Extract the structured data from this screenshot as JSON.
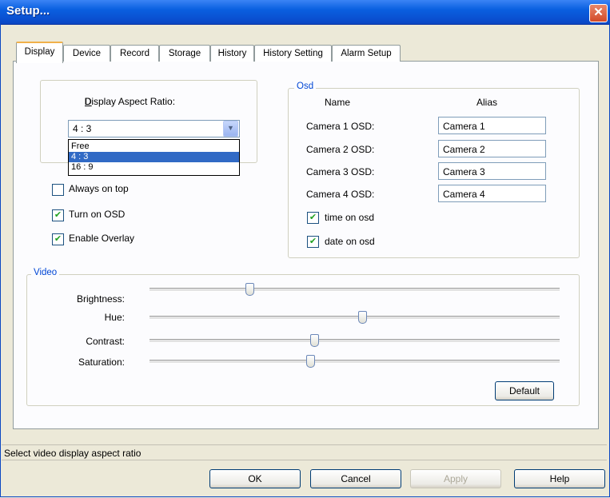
{
  "window": {
    "title": "Setup...",
    "close_glyph": "✕"
  },
  "tabs": [
    "Display",
    "Device",
    "Record",
    "Storage",
    "History",
    "History Setting",
    "Alarm Setup"
  ],
  "display_aspect": {
    "label": "Display Aspect Ratio:",
    "selected": "4 : 3",
    "options": [
      "Free",
      "4 : 3",
      "16 : 9"
    ]
  },
  "checkboxes": {
    "always_on_top": {
      "label": "Always on top",
      "checked": false
    },
    "turn_on_osd": {
      "label": "Turn on OSD",
      "checked": true
    },
    "enable_overlay": {
      "label": "Enable Overlay",
      "checked": true
    }
  },
  "osd": {
    "legend": "Osd",
    "col_name": "Name",
    "col_alias": "Alias",
    "rows": [
      {
        "name": "Camera 1 OSD:",
        "alias": "Camera 1"
      },
      {
        "name": "Camera 2 OSD:",
        "alias": "Camera 2"
      },
      {
        "name": "Camera 3 OSD:",
        "alias": "Camera 3"
      },
      {
        "name": "Camera 4 OSD:",
        "alias": "Camera 4"
      }
    ],
    "time_on_osd": {
      "label": "time on osd",
      "checked": true
    },
    "date_on_osd": {
      "label": "date on osd",
      "checked": true
    }
  },
  "video": {
    "legend": "Video",
    "sliders": [
      {
        "label": "Brightness:",
        "value": 0.24
      },
      {
        "label": "Hue:",
        "value": 0.52
      },
      {
        "label": "Contrast:",
        "value": 0.4
      },
      {
        "label": "Saturation:",
        "value": 0.39
      }
    ],
    "default_label": "Default"
  },
  "status": "Select video display aspect ratio",
  "buttons": {
    "ok": "OK",
    "cancel": "Cancel",
    "apply": "Apply",
    "help": "Help"
  },
  "icons": {
    "close": "close-icon",
    "dropdown": "chevron-down-icon",
    "check": "checkmark-icon"
  }
}
